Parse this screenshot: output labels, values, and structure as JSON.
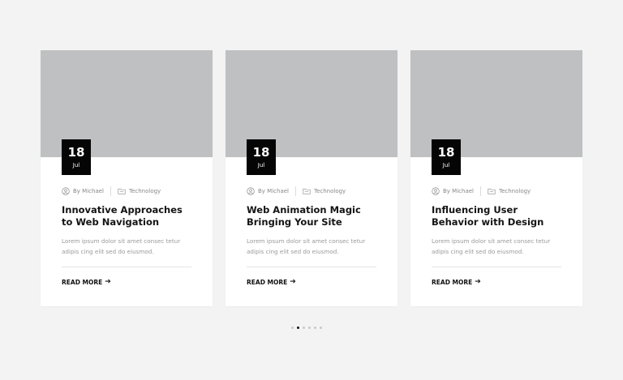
{
  "cards": [
    {
      "date_day": "18",
      "date_month": "Jul",
      "author": "By Michael",
      "category": "Technology",
      "title": "Innovative Approaches to Web Navigation",
      "excerpt": "Lorem ipsum dolor sit amet consec tetur adipis cing elit sed do eiusmod.",
      "read_more": "READ MORE"
    },
    {
      "date_day": "18",
      "date_month": "Jul",
      "author": "By Michael",
      "category": "Technology",
      "title": "Web Animation Magic Bringing Your Site",
      "excerpt": "Lorem ipsum dolor sit amet consec tetur adipis cing elit sed do eiusmod.",
      "read_more": "READ MORE"
    },
    {
      "date_day": "18",
      "date_month": "Jul",
      "author": "By Michael",
      "category": "Technology",
      "title": "Influencing User Behavior with Design",
      "excerpt": "Lorem ipsum dolor sit amet consec tetur adipis cing elit sed do eiusmod.",
      "read_more": "READ MORE"
    }
  ],
  "pagination": {
    "count": 6,
    "active_index": 1
  },
  "icons": {
    "author": "user-circle-icon",
    "category": "folder-icon",
    "read_more": "arrow-right-icon"
  },
  "colors": {
    "background": "#f3f3f3",
    "card": "#ffffff",
    "image_placeholder": "#bfc0c1",
    "date_badge": "#050505",
    "muted_text": "#9a9a9a",
    "active_dot": "#111111",
    "inactive_dot": "#c8c8c8"
  }
}
